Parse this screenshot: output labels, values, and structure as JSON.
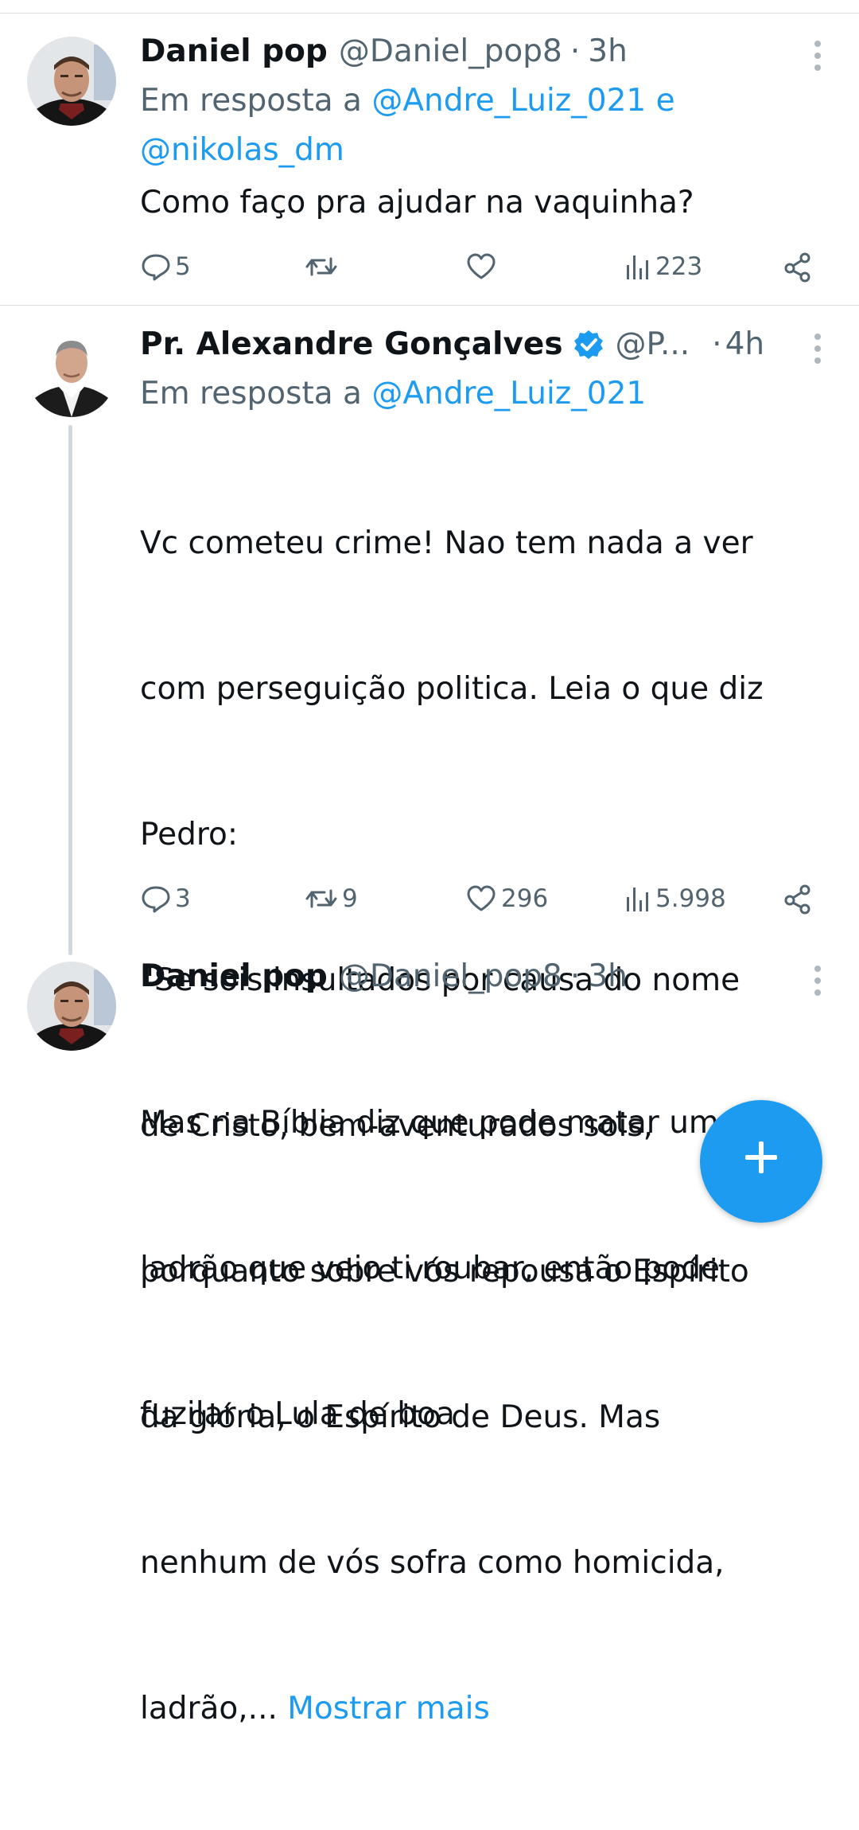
{
  "colors": {
    "accent": "#1d9bf0",
    "secondary_text": "#536471",
    "primary_text": "#0f1419",
    "divider": "#d8dde2"
  },
  "tweets": [
    {
      "name": "Daniel pop",
      "handle": "@Daniel_pop8",
      "dot": "·",
      "time": "3h",
      "reply_prefix": "Em resposta a",
      "reply_mention_1": "@Andre_Luiz_021",
      "reply_joiner": "e",
      "reply_mention_2": "@nikolas_dm",
      "text": "Como faço pra ajudar na vaquinha?",
      "replies": "5",
      "retweets": "",
      "likes": "",
      "views": "223",
      "icons": [
        "avatar",
        "more-vertical-icon",
        "reply-icon",
        "retweet-icon",
        "like-icon",
        "views-icon",
        "share-icon"
      ]
    },
    {
      "name": "Pr. Alexandre Gonçalves",
      "verified": true,
      "handle": "@P...",
      "dot": "·",
      "time": "4h",
      "reply_prefix": "Em resposta a",
      "reply_mention_1": "@Andre_Luiz_021",
      "text_lines": [
        "Vc cometeu crime! Nao tem nada a ver",
        "com perseguição politica. Leia o que diz",
        "Pedro:",
        "\"Se sois insultados por causa do nome",
        "de Cristo, bem-aventurados sois,",
        "porquanto sobre vós repousa o Espírito",
        "da glória, o Espírito de Deus. Mas",
        "nenhum de vós sofra como homicida,"
      ],
      "last_line": "ladrão,...",
      "show_more": "Mostrar mais",
      "replies": "3",
      "retweets": "9",
      "likes": "296",
      "views": "5.998"
    },
    {
      "name": "Daniel pop",
      "handle": "@Daniel_pop8",
      "dot": "·",
      "time": "3h",
      "text_lines": [
        "Mas na Bíblia diz que pode matar um",
        "ladrão que veio ti roubar, então pode",
        "fuzilar o Lula de boa"
      ]
    }
  ],
  "fab": {
    "icon": "compose-plus-icon"
  }
}
